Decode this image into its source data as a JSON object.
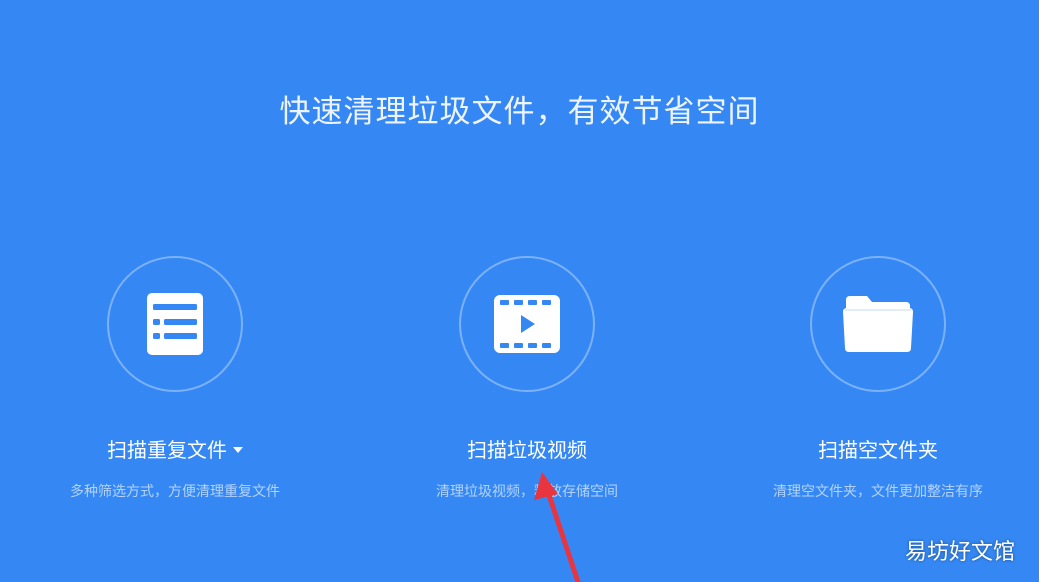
{
  "headline": "快速清理垃圾文件，有效节省空间",
  "cards": [
    {
      "title": "扫描重复文件",
      "description": "多种筛选方式，方便清理重复文件",
      "icon": "list-document-icon"
    },
    {
      "title": "扫描垃圾视频",
      "description": "清理垃圾视频，释放存储空间",
      "icon": "video-film-icon"
    },
    {
      "title": "扫描空文件夹",
      "description": "清理空文件夹，文件更加整洁有序",
      "icon": "folder-icon"
    }
  ],
  "watermark": "易坊好文馆",
  "colors": {
    "background": "#3588f4",
    "arrow": "#e8353f"
  }
}
